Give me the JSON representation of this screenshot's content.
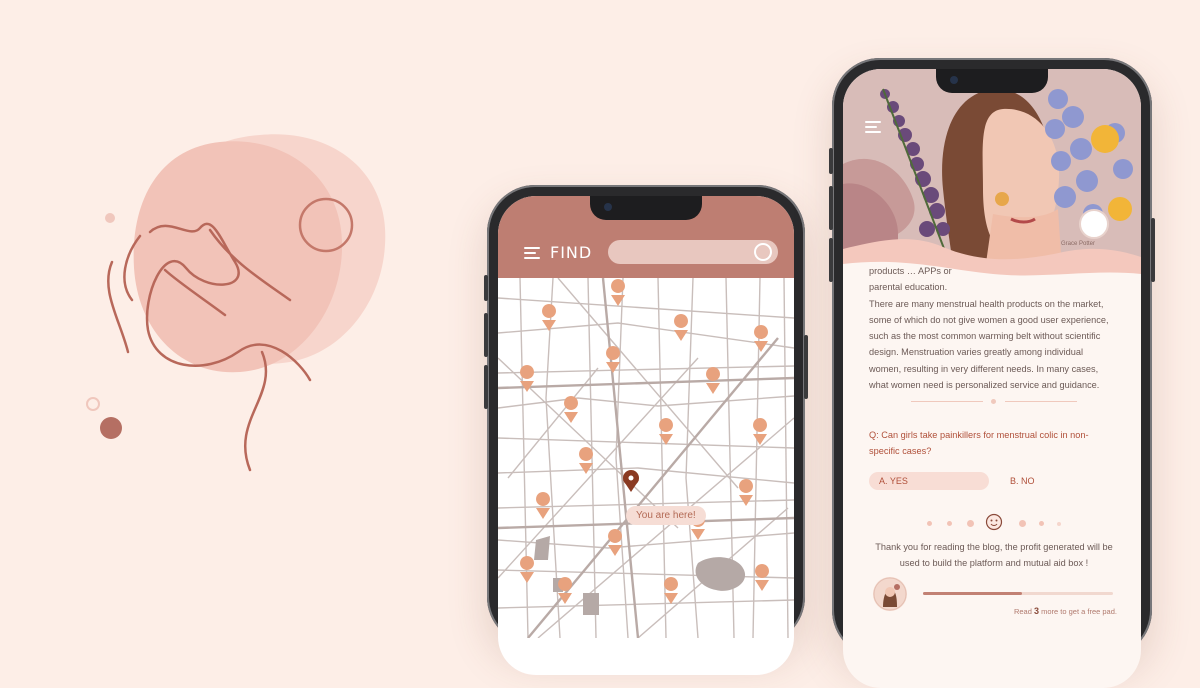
{
  "colors": {
    "background": "#fdeee7",
    "header": "#be7e72",
    "pin": "#e8a27e",
    "pin_current": "#8a3a22",
    "accent_text": "#b0503a"
  },
  "map_app": {
    "header_title": "FIND",
    "search_placeholder": "",
    "current_location_label": "You are here!"
  },
  "blog_app": {
    "author": "Grace Potter",
    "article_lines": [
      "products … APPs or",
      "parental education.",
      "There are many menstrual health products on the market,",
      "some of which do not give women a good user experience,",
      "such as the most common warming belt without scientific",
      "design. Menstruation varies greatly among individual",
      "women, resulting in very different needs. In many cases,",
      "what women need is personalized service and guidance."
    ],
    "question": "Q: Can girls take painkillers for menstrual colic in non-specific cases?",
    "option_a": "A. YES",
    "option_b": "B. NO",
    "thanks_text": "Thank you for reading the blog, the profit generated will be used to build the platform and mutual aid box !",
    "progress_fraction": 0.52,
    "read_prefix": "Read",
    "read_count": "3",
    "read_suffix": "more to get a free pad."
  }
}
